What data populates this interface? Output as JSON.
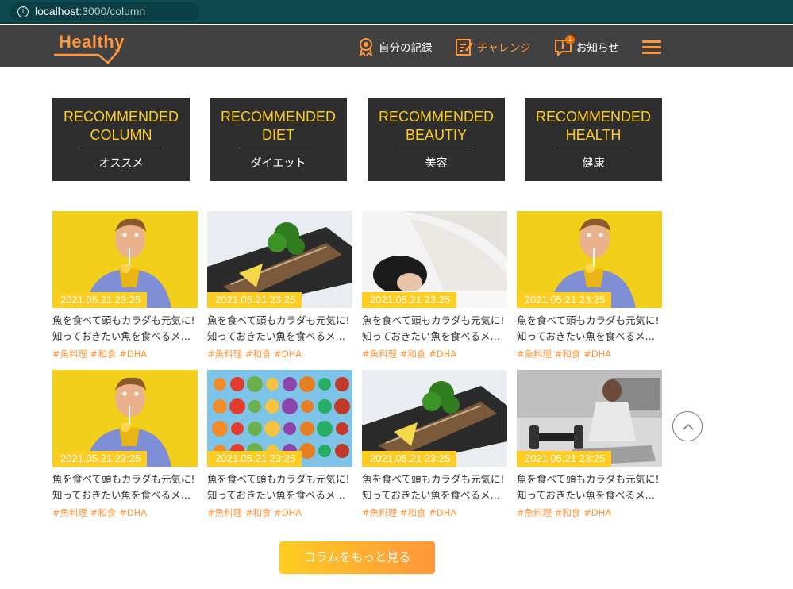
{
  "browser": {
    "url_host": "localhost",
    "url_rest": ":3000/column"
  },
  "header": {
    "logo": "Healthy",
    "nav": [
      {
        "label": "自分の記録"
      },
      {
        "label": "チャレンジ"
      },
      {
        "label": "お知らせ",
        "badge": "1"
      }
    ]
  },
  "categories": [
    {
      "title_1": "RECOMMENDED",
      "title_2": "COLUMN",
      "sub": "オススメ"
    },
    {
      "title_1": "RECOMMENDED",
      "title_2": "DIET",
      "sub": "ダイエット"
    },
    {
      "title_1": "RECOMMENDED",
      "title_2": "BEAUTIY",
      "sub": "美容"
    },
    {
      "title_1": "RECOMMENDED",
      "title_2": "HEALTH",
      "sub": "健康"
    }
  ],
  "articles": [
    {
      "date": "2021.05.21 23:25",
      "line1": "魚を食べて頭もカラダも元気に!",
      "line2": "知っておきたい魚を食べるメリ…",
      "tags": "#魚料理 #和食 #DHA",
      "image": "man-juice"
    },
    {
      "date": "2021.05.21 23:25",
      "line1": "魚を食べて頭もカラダも元気に!",
      "line2": "知っておきたい魚を食べるメリ…",
      "tags": "#魚料理 #和食 #DHA",
      "image": "grilled-fish"
    },
    {
      "date": "2021.05.21 23:25",
      "line1": "魚を食べて頭もカラダも元気に!",
      "line2": "知っておきたい魚を食べるメリ…",
      "tags": "#魚料理 #和食 #DHA",
      "image": "sleeping-woman"
    },
    {
      "date": "2021.05.21 23:25",
      "line1": "魚を食べて頭もカラダも元気に!",
      "line2": "知っておきたい魚を食べるメリ…",
      "tags": "#魚料理 #和食 #DHA",
      "image": "man-juice"
    },
    {
      "date": "2021.05.21 23:25",
      "line1": "魚を食べて頭もカラダも元気に!",
      "line2": "知っておきたい魚を食べるメリ…",
      "tags": "#魚料理 #和食 #DHA",
      "image": "man-juice"
    },
    {
      "date": "2021.05.21 23:25",
      "line1": "魚を食べて頭もカラダも元気に!",
      "line2": "知っておきたい魚を食べるメリ…",
      "tags": "#魚料理 #和食 #DHA",
      "image": "vegetables"
    },
    {
      "date": "2021.05.21 23:25",
      "line1": "魚を食べて頭もカラダも元気に!",
      "line2": "知っておきたい魚を食べるメリ…",
      "tags": "#魚料理 #和食 #DHA",
      "image": "grilled-fish"
    },
    {
      "date": "2021.05.21 23:25",
      "line1": "魚を食べて頭もカラダも元気に!",
      "line2": "知っておきたい魚を食べるメリ…",
      "tags": "#魚料理 #和食 #DHA",
      "image": "dumbbell-woman"
    }
  ],
  "more_button": "コラムをもっと見る",
  "colors": {
    "primary": "#ff963c",
    "accent": "#ffcc21",
    "dark": "#2e2e2e",
    "header": "#414141"
  }
}
